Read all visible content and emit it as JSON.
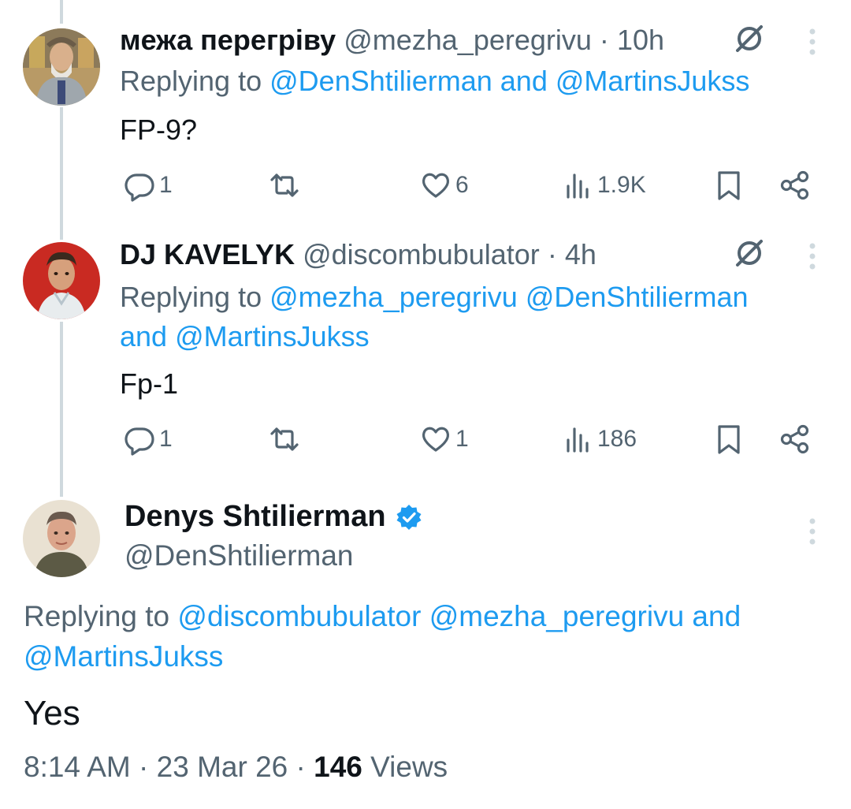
{
  "replies": [
    {
      "display_name": "межа перегріву",
      "handle": "@mezha_peregrivu",
      "separator": "·",
      "time": "10h",
      "replying_prefix": "Replying to",
      "replying_line1": "@DenShtilierman and @MartinsJukss",
      "replying_line2": "",
      "text": "FP-9?",
      "replies_count": "1",
      "reposts_count": "",
      "likes_count": "6",
      "views_count": "1.9K"
    },
    {
      "display_name": "DJ KAVELYK",
      "handle": "@discombubulator",
      "separator": "·",
      "time": "4h",
      "replying_prefix": "Replying to",
      "replying_line1": "@mezha_peregrivu @DenShtilierman",
      "replying_line2": "and @MartinsJukss",
      "text": "Fp-1",
      "replies_count": "1",
      "reposts_count": "",
      "likes_count": "1",
      "views_count": "186"
    }
  ],
  "main_post": {
    "display_name": "Denys Shtilierman",
    "handle": "@DenShtilierman",
    "replying_prefix": "Replying to",
    "replying_line1": "@discombubulator @mezha_peregrivu and",
    "replying_line2": "@MartinsJukss",
    "text": "Yes",
    "time": "8:14 AM",
    "date": "23 Mar 26",
    "separator": "·",
    "views_count": "146",
    "views_label": "Views"
  },
  "colors": {
    "link": "#1d9bf0",
    "muted": "#536471",
    "text": "#0f1419",
    "thread_line": "#cfd9de",
    "verified": "#1d9bf0"
  },
  "icons": [
    "reply-icon",
    "repost-icon",
    "like-icon",
    "views-icon",
    "bookmark-icon",
    "share-icon",
    "grok-icon",
    "more-icon",
    "verified-badge-icon"
  ]
}
